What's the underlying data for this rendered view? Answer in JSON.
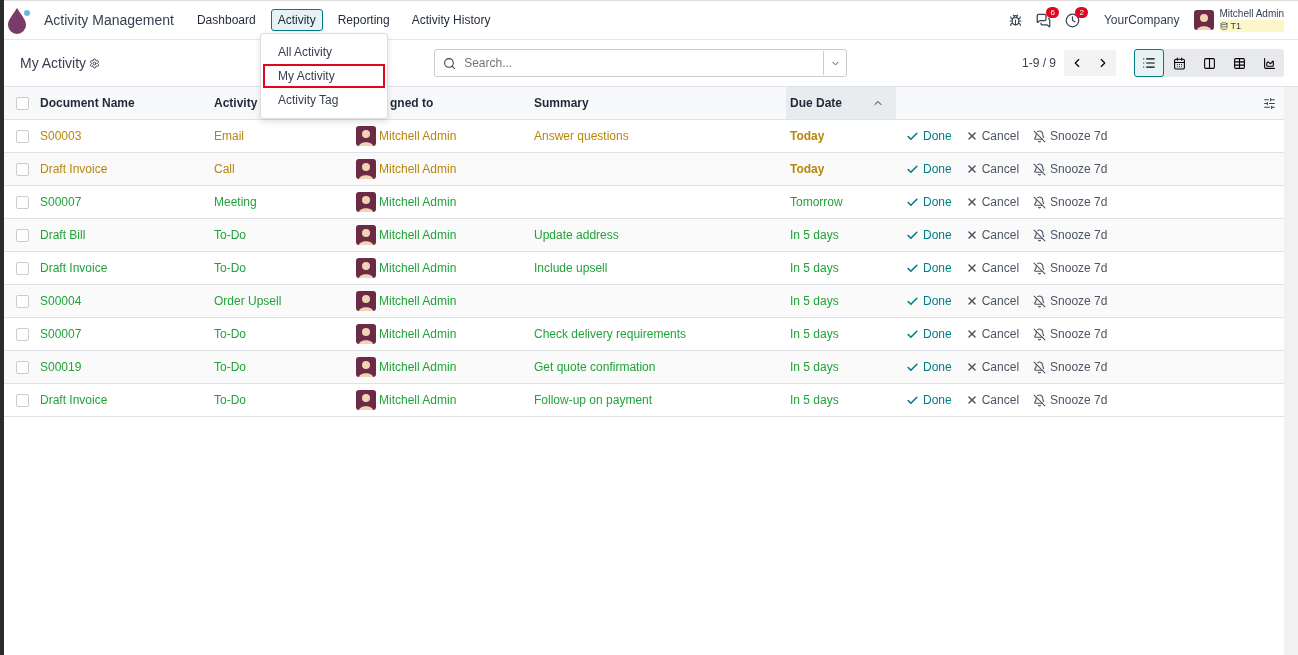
{
  "navbar": {
    "app_name": "Activity Management",
    "menu": [
      {
        "label": "Dashboard",
        "selected": false
      },
      {
        "label": "Activity",
        "selected": true
      },
      {
        "label": "Reporting",
        "selected": false
      },
      {
        "label": "Activity History",
        "selected": false
      }
    ],
    "messages_count": "6",
    "activities_count": "2",
    "company": "YourCompany",
    "user": {
      "name": "Mitchell Admin",
      "database": "T1"
    }
  },
  "dropdown": {
    "items": [
      {
        "label": "All Activity",
        "selected": false
      },
      {
        "label": "My Activity",
        "selected": true
      },
      {
        "label": "Activity Tag",
        "selected": false
      }
    ]
  },
  "control_panel": {
    "title": "My Activity",
    "search": {
      "placeholder": "Search..."
    },
    "pager": "1-9 / 9",
    "views": [
      {
        "kind": "list",
        "selected": true
      },
      {
        "kind": "calendar",
        "selected": false
      },
      {
        "kind": "kanban",
        "selected": false
      },
      {
        "kind": "pivot",
        "selected": false
      },
      {
        "kind": "graph",
        "selected": false
      }
    ]
  },
  "table": {
    "select_all_checked": false,
    "columns": [
      "Document Name",
      "Activity",
      "gned to",
      "Summary",
      "Due Date"
    ],
    "rows": [
      {
        "checked": false,
        "kind": "today",
        "document": "S00003",
        "activity": "Email",
        "assigned": "Mitchell Admin",
        "summary": "Answer questions",
        "due": "Today",
        "actions": [
          "Done",
          "Cancel",
          "Snooze 7d"
        ]
      },
      {
        "checked": false,
        "kind": "today",
        "document": "Draft Invoice",
        "activity": "Call",
        "assigned": "Mitchell Admin",
        "due": "Today",
        "actions": [
          "Done",
          "Cancel",
          "Snooze 7d"
        ]
      },
      {
        "checked": false,
        "kind": "planned",
        "document": "S00007",
        "activity": "Meeting",
        "assigned": "Mitchell Admin",
        "due": "Tomorrow",
        "actions": [
          "Done",
          "Cancel",
          "Snooze 7d"
        ]
      },
      {
        "checked": false,
        "kind": "planned",
        "document": "Draft Bill",
        "activity": "To-Do",
        "assigned": "Mitchell Admin",
        "summary": "Update address",
        "due": "In 5 days",
        "actions": [
          "Done",
          "Cancel",
          "Snooze 7d"
        ]
      },
      {
        "checked": false,
        "kind": "planned",
        "document": "Draft Invoice",
        "activity": "To-Do",
        "assigned": "Mitchell Admin",
        "summary": "Include upsell",
        "due": "In 5 days",
        "actions": [
          "Done",
          "Cancel",
          "Snooze 7d"
        ]
      },
      {
        "checked": false,
        "kind": "planned",
        "document": "S00004",
        "activity": "Order Upsell",
        "assigned": "Mitchell Admin",
        "due": "In 5 days",
        "actions": [
          "Done",
          "Cancel",
          "Snooze 7d"
        ]
      },
      {
        "checked": false,
        "kind": "planned",
        "document": "S00007",
        "activity": "To-Do",
        "assigned": "Mitchell Admin",
        "summary": "Check delivery requirements",
        "due": "In 5 days",
        "actions": [
          "Done",
          "Cancel",
          "Snooze 7d"
        ]
      },
      {
        "checked": false,
        "kind": "planned",
        "document": "S00019",
        "activity": "To-Do",
        "assigned": "Mitchell Admin",
        "summary": "Get quote confirmation",
        "due": "In 5 days",
        "actions": [
          "Done",
          "Cancel",
          "Snooze 7d"
        ]
      },
      {
        "checked": false,
        "kind": "planned",
        "document": "Draft Invoice",
        "activity": "To-Do",
        "assigned": "Mitchell Admin",
        "summary": "Follow-up on payment",
        "due": "In 5 days",
        "actions": [
          "Done",
          "Cancel",
          "Snooze 7d"
        ]
      }
    ]
  }
}
